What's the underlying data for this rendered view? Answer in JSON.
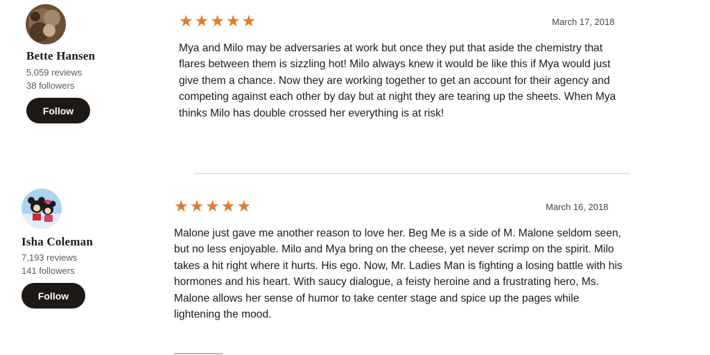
{
  "reviews": [
    {
      "reviewer": {
        "name": "Bette Hansen",
        "reviews": "5,059 reviews",
        "followers": "38 followers",
        "follow_label": "Follow"
      },
      "rating": 5,
      "stars": "★★★★★",
      "date": "March 17, 2018",
      "text": "Mya and Milo may be adversaries at work but once they put that aside the chemistry that flares between them is sizzling hot! Milo always knew it would be like this if Mya would just give them a chance. Now they are working together to get an account for their agency and competing against each other by day but at night they are tearing up the sheets. When Mya thinks Milo has double crossed her everything is at risk!"
    },
    {
      "reviewer": {
        "name": "Isha Coleman",
        "reviews": "7,193 reviews",
        "followers": "141 followers",
        "follow_label": "Follow"
      },
      "rating": 5,
      "stars": "★★★★★",
      "date": "March 16, 2018",
      "text": "Malone just gave me another reason to love her. Beg Me is a side of M. Malone seldom seen, but no less enjoyable. Milo and Mya bring on the cheese, yet never scrimp on the spirit. Milo takes a hit right where it hurts. His ego. Now, Mr. Ladies Man is fighting a losing battle with his hormones and his heart. With saucy dialogue, a feisty heroine and a frustrating hero, Ms. Malone allows her sense of humor to take center stage and spice up the pages while lightening the mood."
    }
  ],
  "colors": {
    "star": "#e07a2c",
    "button_bg": "#1e1915",
    "button_text": "#ffffff",
    "divider": "#d0cdc9"
  }
}
